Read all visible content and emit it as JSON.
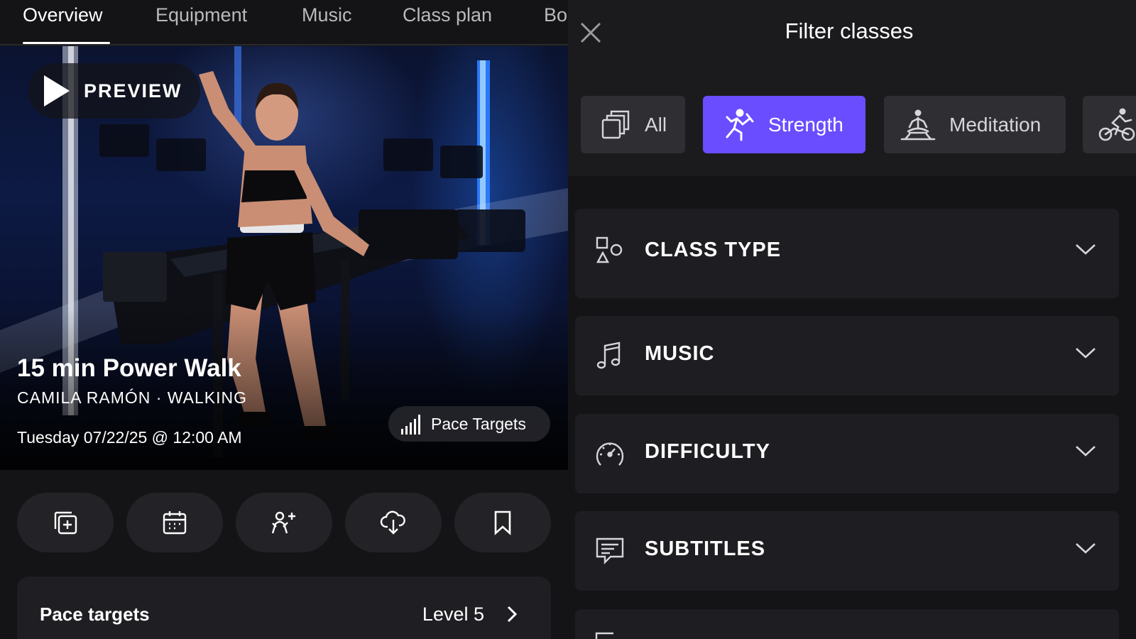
{
  "tabs": [
    {
      "label": "Overview",
      "active": true
    },
    {
      "label": "Equipment",
      "active": false
    },
    {
      "label": "Music",
      "active": false
    },
    {
      "label": "Class plan",
      "active": false
    },
    {
      "label": "Bo",
      "active": false
    }
  ],
  "hero": {
    "preview_label": "PREVIEW",
    "title": "15 min Power Walk",
    "subtitle": "CAMILA RAMÓN · WALKING",
    "date": "Tuesday 07/22/25 @ 12:00 AM",
    "badge_label": "Pace Targets"
  },
  "actions": [
    {
      "name": "add-to-stack",
      "icon": "stack-add-icon"
    },
    {
      "name": "schedule",
      "icon": "calendar-icon"
    },
    {
      "name": "invite",
      "icon": "user-add-icon"
    },
    {
      "name": "download",
      "icon": "cloud-download-icon"
    },
    {
      "name": "bookmark",
      "icon": "bookmark-icon"
    }
  ],
  "pace_card": {
    "title": "Pace targets",
    "value": "Level 5"
  },
  "filter": {
    "title": "Filter classes",
    "chips": [
      {
        "label": "All",
        "icon": "stack-icon",
        "selected": false
      },
      {
        "label": "Strength",
        "icon": "strength-icon",
        "selected": true
      },
      {
        "label": "Meditation",
        "icon": "meditation-icon",
        "selected": false
      },
      {
        "label": "",
        "icon": "cycling-icon",
        "selected": false
      }
    ],
    "sections": [
      {
        "label": "CLASS TYPE",
        "icon": "shapes-icon"
      },
      {
        "label": "MUSIC",
        "icon": "music-note-icon"
      },
      {
        "label": "DIFFICULTY",
        "icon": "gauge-icon"
      },
      {
        "label": "SUBTITLES",
        "icon": "subtitles-icon"
      }
    ]
  },
  "colors": {
    "accent": "#6a4dff",
    "background": "#141416",
    "card": "#1e1e22"
  }
}
